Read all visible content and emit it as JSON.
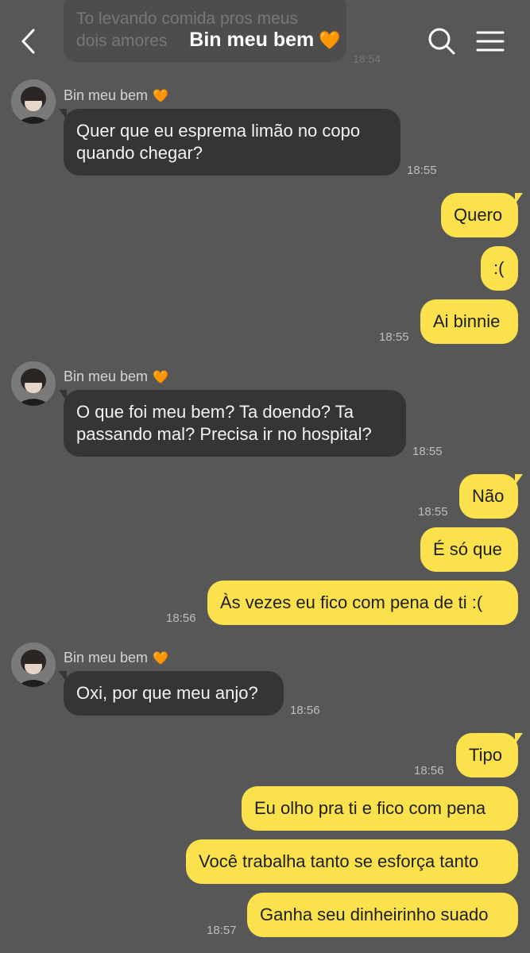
{
  "header": {
    "title": "Bin meu bem",
    "heart": "🧡",
    "back_icon": "chevron-left-icon",
    "search_icon": "search-icon",
    "menu_icon": "menu-icon",
    "prev_message": "To levando comida pros meus\ndois amores",
    "prev_time": "18:54"
  },
  "contact": {
    "name": "Bin meu bem",
    "heart": "🧡"
  },
  "messages": [
    {
      "text": "Quer que eu esprema limão no copo\nquando chegar?",
      "time": "18:55"
    },
    {
      "text": "Quero"
    },
    {
      "text": ":("
    },
    {
      "text": "Ai binnie",
      "time": "18:55"
    },
    {
      "text": "O que foi meu bem? Ta doendo? Ta\npassando mal? Precisa ir no hospital?",
      "time": "18:55"
    },
    {
      "text": "Não",
      "time": "18:55"
    },
    {
      "text": "É só que"
    },
    {
      "text": "Às vezes eu fico com pena de ti :(",
      "time": "18:56"
    },
    {
      "text": "Oxi, por que meu anjo?",
      "time": "18:56"
    },
    {
      "text": "Tipo",
      "time": "18:56"
    },
    {
      "text": "Eu olho pra ti e fico com pena"
    },
    {
      "text": "Você trabalha tanto se esforça tanto"
    },
    {
      "text": "Ganha seu dinheirinho suado",
      "time": "18:57"
    }
  ],
  "colors": {
    "background": "#575757",
    "incoming_bubble": "#353535",
    "outgoing_bubble": "#fbe14c"
  }
}
